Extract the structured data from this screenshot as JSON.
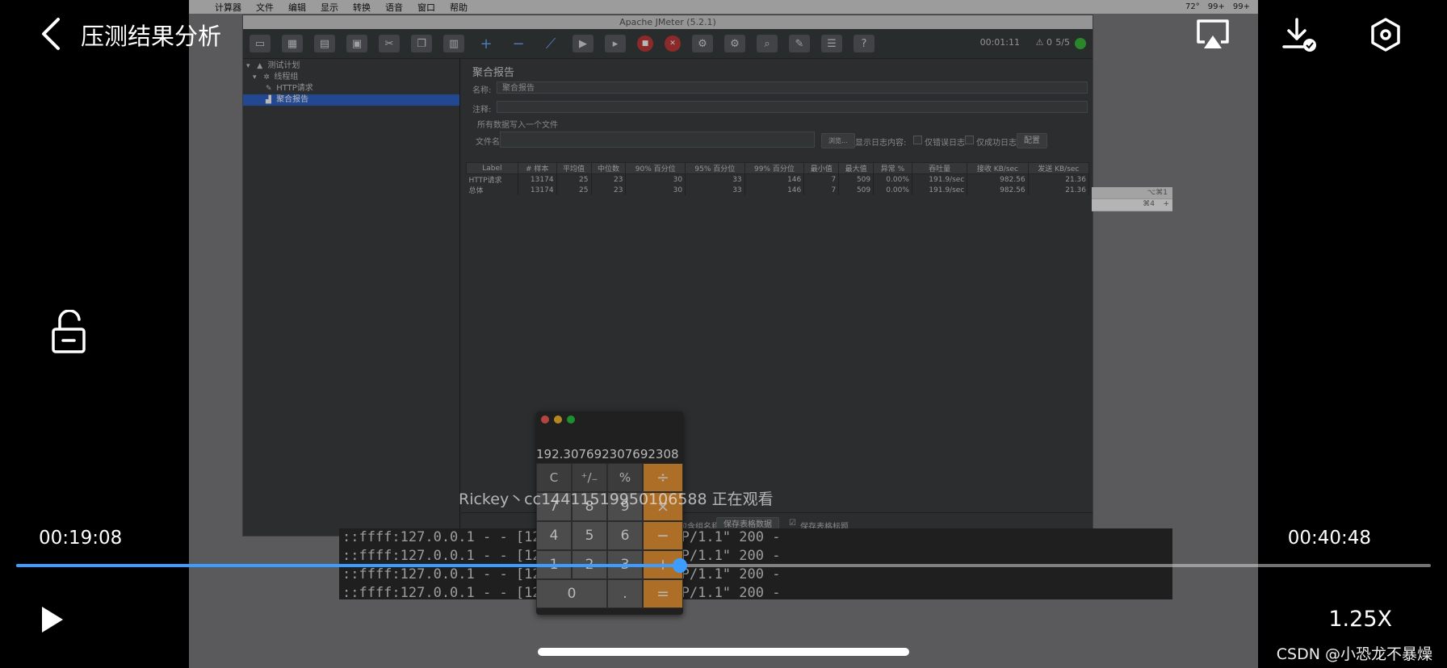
{
  "player": {
    "title": "压测结果分析",
    "current_time": "00:19:08",
    "total_time": "00:40:48",
    "progress_fraction": 0.469,
    "speed": "1.25X",
    "watcher_notice": "Rickey丶cc14411519950106588 正在观看",
    "watermark": "CSDN @小恐龙不暴燥",
    "accent_color": "#3d9dff"
  },
  "mac_menubar": {
    "apple": "",
    "items": [
      "计算器",
      "文件",
      "编辑",
      "显示",
      "转换",
      "语音",
      "窗口",
      "帮助"
    ],
    "status": [
      "72°",
      "99+",
      "99+"
    ]
  },
  "jmeter": {
    "window_title": "Apache JMeter (5.2.1)",
    "timer": "00:01:11",
    "warnings": "0",
    "threads": "5/5",
    "tree": {
      "plan": "测试计划",
      "thread_group": "线程组",
      "http_request": "HTTP请求",
      "aggregate_report": "聚合报告"
    },
    "panel": {
      "title": "聚合报告",
      "name_label": "名称:",
      "name_value": "聚合报告",
      "comment_label": "注释:",
      "write_all_label": "所有数据写入一个文件",
      "filename_label": "文件名",
      "browse_button": "浏览...",
      "log_content_label": "显示日志内容:",
      "errors_only_label": "仅错误日志",
      "success_only_label": "仅成功日志",
      "config_button": "配置",
      "group_name_label": "标签中包含组名称?",
      "save_data_button": "保存表格数据",
      "save_header_label": "保存表格标题"
    },
    "table": {
      "headers": [
        "Label",
        "# 样本",
        "平均值",
        "中位数",
        "90% 百分位",
        "95% 百分位",
        "99% 百分位",
        "最小值",
        "最大值",
        "异常 %",
        "吞吐量",
        "接收 KB/sec",
        "发送 KB/sec"
      ],
      "rows": [
        [
          "HTTP请求",
          "13174",
          "25",
          "23",
          "30",
          "33",
          "146",
          "7",
          "509",
          "0.00%",
          "191.9/sec",
          "982.56",
          "21.36"
        ],
        [
          "总体",
          "13174",
          "25",
          "23",
          "30",
          "33",
          "146",
          "7",
          "509",
          "0.00%",
          "191.9/sec",
          "982.56",
          "21.36"
        ]
      ]
    }
  },
  "side_window": {
    "shortcut_top": "⌥⌘1",
    "shortcut_row": "⌘4",
    "plus": "+"
  },
  "terminal": {
    "lines": [
      "::ffff:127.0.0.1 - - [12/...4] \"GET / HTTP/1.1\" 200 -",
      "::ffff:127.0.0.1 - - [12/...4] \"GET / HTTP/1.1\" 200 -",
      "::ffff:127.0.0.1 - - [12/...4] \"GET / HTTP/1.1\" 200 -",
      "::ffff:127.0.0.1 - - [12/...4] \"GET / HTTP/1.1\" 200 -"
    ]
  },
  "calculator": {
    "display": "192.307692307692308",
    "keys": {
      "clear": "C",
      "sign": "⁺∕₋",
      "percent": "%",
      "divide": "÷",
      "seven": "7",
      "eight": "8",
      "nine": "9",
      "multiply": "×",
      "four": "4",
      "five": "5",
      "six": "6",
      "minus": "−",
      "one": "1",
      "two": "2",
      "three": "3",
      "plus": "+",
      "zero": "0",
      "decimal": ".",
      "equals": "="
    }
  }
}
